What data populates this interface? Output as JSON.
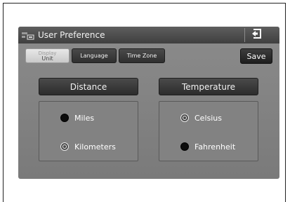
{
  "window": {
    "title": "User Preference",
    "app_icon": "preference-app-icon",
    "back_icon": "back-exit-icon"
  },
  "tabs": [
    {
      "label_line1": "Display",
      "label_line2": "Unit",
      "active": true
    },
    {
      "label": "Language",
      "active": false
    },
    {
      "label": "Time Zone",
      "active": false
    }
  ],
  "toolbar": {
    "save_label": "Save"
  },
  "groups": {
    "distance": {
      "title": "Distance",
      "options": [
        {
          "label": "Miles",
          "selected": false
        },
        {
          "label": "Kilometers",
          "selected": true
        }
      ]
    },
    "temperature": {
      "title": "Temperature",
      "options": [
        {
          "label": "Celsius",
          "selected": true
        },
        {
          "label": "Fahrenheit",
          "selected": false
        }
      ]
    }
  },
  "colors": {
    "screen_bg": "#828282",
    "titlebar_bg": "#4a4a4a",
    "button_bg": "#2f2f2f",
    "text": "#ffffff"
  }
}
